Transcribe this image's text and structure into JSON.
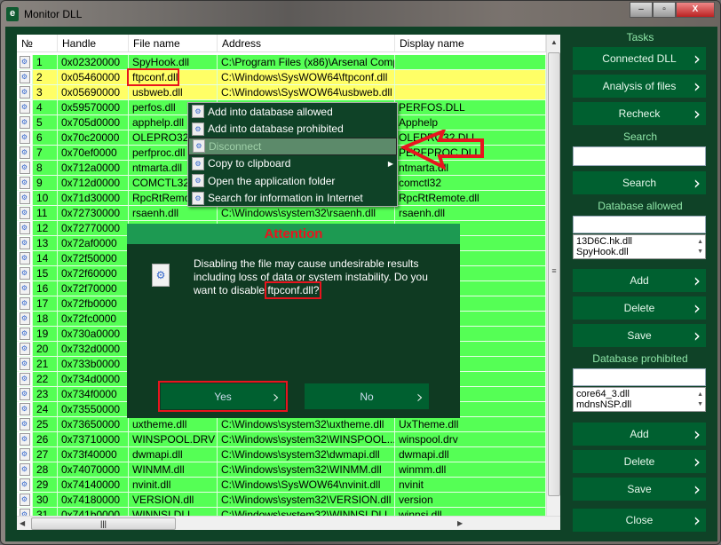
{
  "window": {
    "title": "Monitor DLL",
    "icon": "app-e-icon",
    "controls": [
      "minimize",
      "maximize",
      "close"
    ]
  },
  "table": {
    "columns": [
      "№",
      "Handle",
      "File name",
      "Address",
      "Display name"
    ],
    "rows": [
      {
        "n": "1",
        "handle": "0x02320000",
        "file": "SpyHook.dll",
        "address": "C:\\Program Files (x86)\\Arsenal Comp...",
        "display": "",
        "status": "allowed"
      },
      {
        "n": "2",
        "handle": "0x05460000",
        "file": "ftpconf.dll",
        "address": "C:\\Windows\\SysWOW64\\ftpconf.dll",
        "display": "",
        "status": "unknown"
      },
      {
        "n": "3",
        "handle": "0x05690000",
        "file": "usbweb.dll",
        "address": "C:\\Windows\\SysWOW64\\usbweb.dll",
        "display": "",
        "status": "unknown"
      },
      {
        "n": "4",
        "handle": "0x59570000",
        "file": "perfos.dll",
        "address": "",
        "display": "PERFOS.DLL",
        "status": "allowed"
      },
      {
        "n": "5",
        "handle": "0x705d0000",
        "file": "apphelp.dll",
        "address": "",
        "display": "Apphelp",
        "status": "allowed"
      },
      {
        "n": "6",
        "handle": "0x70c20000",
        "file": "OLEPRO32.DLL",
        "address": "",
        "display": "OLEPRO32.DLL",
        "status": "allowed"
      },
      {
        "n": "7",
        "handle": "0x70ef0000",
        "file": "perfproc.dll",
        "address": "",
        "display": "PERFPROC.DLL",
        "status": "allowed"
      },
      {
        "n": "8",
        "handle": "0x712a0000",
        "file": "ntmarta.dll",
        "address": "",
        "display": "ntmarta.dll",
        "status": "allowed"
      },
      {
        "n": "9",
        "handle": "0x712d0000",
        "file": "COMCTL32.dll",
        "address": "",
        "display": "comctl32",
        "status": "allowed"
      },
      {
        "n": "10",
        "handle": "0x71d30000",
        "file": "RpcRtRemote.dll",
        "address": "",
        "display": "RpcRtRemote.dll",
        "status": "allowed"
      },
      {
        "n": "11",
        "handle": "0x72730000",
        "file": "rsaenh.dll",
        "address": "C:\\Windows\\system32\\rsaenh.dll",
        "display": "rsaenh.dll",
        "status": "allowed"
      },
      {
        "n": "12",
        "handle": "0x72770000",
        "file": "",
        "address": "",
        "display": "",
        "status": "allowed"
      },
      {
        "n": "13",
        "handle": "0x72af0000",
        "file": "",
        "address": "",
        "display": "",
        "status": "allowed"
      },
      {
        "n": "14",
        "handle": "0x72f50000",
        "file": "",
        "address": "",
        "display": "",
        "status": "allowed"
      },
      {
        "n": "15",
        "handle": "0x72f60000",
        "file": "",
        "address": "",
        "display": "nd Mapper",
        "status": "allowed"
      },
      {
        "n": "16",
        "handle": "0x72f70000",
        "file": "",
        "address": "",
        "display": "",
        "status": "allowed"
      },
      {
        "n": "17",
        "handle": "0x72fb0000",
        "file": "",
        "address": "",
        "display": "",
        "status": "allowed"
      },
      {
        "n": "18",
        "handle": "0x72fc0000",
        "file": "",
        "address": "",
        "display": "",
        "status": "allowed"
      },
      {
        "n": "19",
        "handle": "0x730a0000",
        "file": "",
        "address": "",
        "display": "cs",
        "status": "allowed"
      },
      {
        "n": "20",
        "handle": "0x732d0000",
        "file": "",
        "address": "",
        "display": "",
        "status": "allowed"
      },
      {
        "n": "21",
        "handle": "0x733b0000",
        "file": "",
        "address": "",
        "display": "",
        "status": "allowed"
      },
      {
        "n": "22",
        "handle": "0x734d0000",
        "file": "",
        "address": "",
        "display": "",
        "status": "allowed"
      },
      {
        "n": "23",
        "handle": "0x734f0000",
        "file": "",
        "address": "",
        "display": "Audio Filter",
        "status": "allowed"
      },
      {
        "n": "24",
        "handle": "0x73550000",
        "file": "",
        "address": "",
        "display": "",
        "status": "allowed"
      },
      {
        "n": "25",
        "handle": "0x73650000",
        "file": "uxtheme.dll",
        "address": "C:\\Windows\\system32\\uxtheme.dll",
        "display": "UxTheme.dll",
        "status": "allowed"
      },
      {
        "n": "26",
        "handle": "0x73710000",
        "file": "WINSPOOL.DRV",
        "address": "C:\\Windows\\system32\\WINSPOOL....",
        "display": "winspool.drv",
        "status": "allowed"
      },
      {
        "n": "27",
        "handle": "0x73f40000",
        "file": "dwmapi.dll",
        "address": "C:\\Windows\\system32\\dwmapi.dll",
        "display": "dwmapi.dll",
        "status": "allowed"
      },
      {
        "n": "28",
        "handle": "0x74070000",
        "file": "WINMM.dll",
        "address": "C:\\Windows\\system32\\WINMM.dll",
        "display": "winmm.dll",
        "status": "allowed"
      },
      {
        "n": "29",
        "handle": "0x74140000",
        "file": "nvinit.dll",
        "address": "C:\\Windows\\SysWOW64\\nvinit.dll",
        "display": "nvinit",
        "status": "allowed"
      },
      {
        "n": "30",
        "handle": "0x74180000",
        "file": "VERSION.dll",
        "address": "C:\\Windows\\system32\\VERSION.dll",
        "display": "version",
        "status": "allowed"
      },
      {
        "n": "31",
        "handle": "0x741b0000",
        "file": "WINNSI.DLL",
        "address": "C:\\Windows\\system32\\WINNSI.DLL",
        "display": "winnsi.dll",
        "status": "allowed"
      }
    ]
  },
  "context_menu": {
    "items": [
      {
        "label": "Add into database allowed",
        "disabled": false
      },
      {
        "label": "Add into database prohibited",
        "disabled": false
      },
      {
        "label": "Disconnect",
        "disabled": true
      },
      {
        "label": "Copy to clipboard",
        "disabled": false,
        "submenu": true
      },
      {
        "label": "Open the application folder",
        "disabled": false
      },
      {
        "label": "Search for information in Internet",
        "disabled": false
      }
    ]
  },
  "dialog": {
    "title": "Attention",
    "message": "Disabling the file may cause undesirable results including loss of data or system instability. Do you want to disable ",
    "file": "ftpconf.dll?",
    "yes": "Yes",
    "no": "No"
  },
  "panel": {
    "tasks_label": "Tasks",
    "connected_dll": "Connected DLL",
    "analysis": "Analysis of files",
    "recheck": "Recheck",
    "search_label": "Search",
    "search_value": "",
    "search_button": "Search",
    "allowed_label": "Database allowed",
    "allowed_input": "",
    "allowed_items": [
      "13D6C.hk.dll",
      "SpyHook.dll"
    ],
    "add": "Add",
    "delete": "Delete",
    "save": "Save",
    "prohibited_label": "Database prohibited",
    "prohibited_input": "",
    "prohibited_items": [
      "core64_3.dll",
      "mdnsNSP.dll"
    ],
    "close": "Close"
  },
  "colors": {
    "allowed_row": "#55ff55",
    "unknown_row": "#ffff66",
    "background": "#0f4227",
    "button": "#006030",
    "highlight": "#e8141e"
  }
}
